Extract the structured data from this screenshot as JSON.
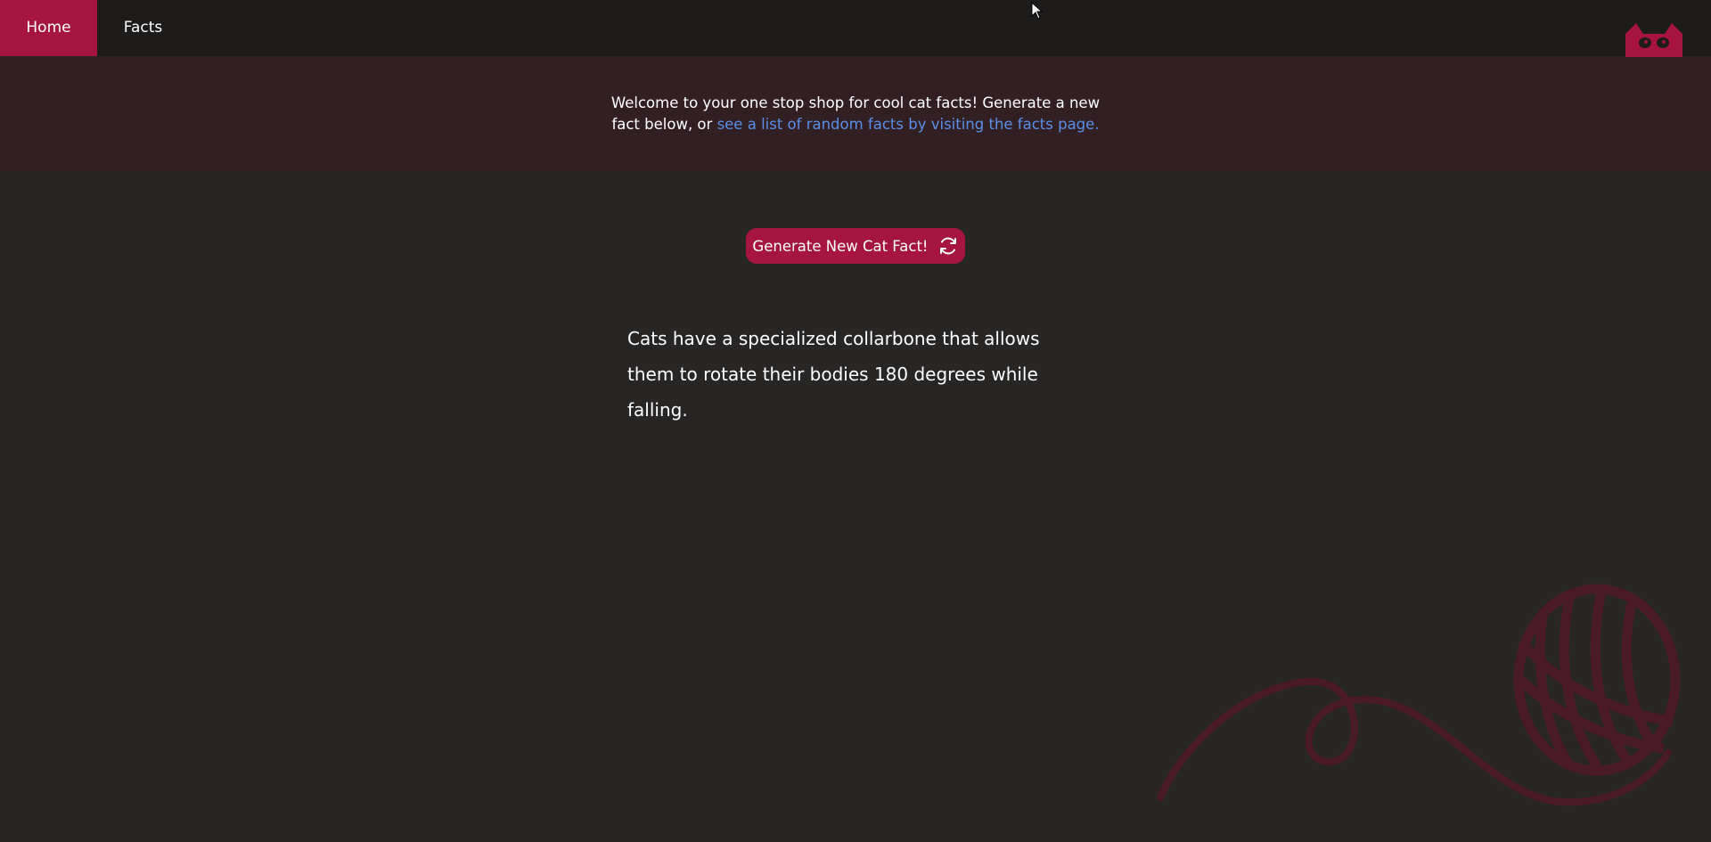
{
  "nav": {
    "home_label": "Home",
    "facts_label": "Facts",
    "logo_icon": "cat-head-icon"
  },
  "banner": {
    "text": "Welcome to your one stop shop for cool cat facts! Generate a new fact below, or ",
    "link_text": "see a list of random facts by visiting the facts page."
  },
  "generate_button": {
    "label": "Generate New Cat Fact!",
    "icon": "refresh-icon"
  },
  "fact": {
    "text": "Cats have a specialized collarbone that allows them to rotate their bodies 180 degrees while falling."
  },
  "decoration": {
    "icon": "yarn-ball-icon"
  },
  "colors": {
    "accent": "#a6153f",
    "background": "#282625",
    "navbar": "#1e1b1b",
    "banner": "#321f23",
    "link": "#5a8fe8"
  }
}
